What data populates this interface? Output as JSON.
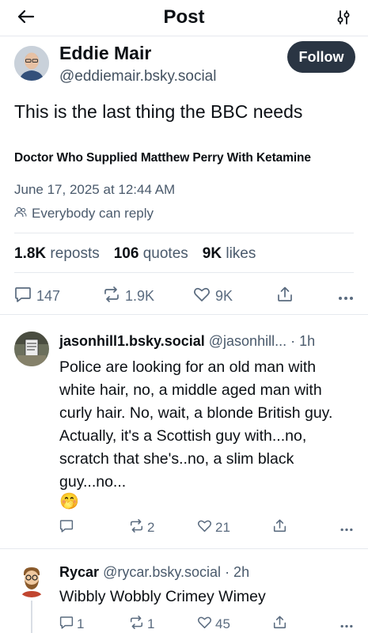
{
  "header": {
    "title": "Post",
    "back_icon": "arrow-left-icon",
    "settings_icon": "sliders-icon"
  },
  "post": {
    "author_name": "Eddie Mair",
    "author_handle": "@eddiemair.bsky.social",
    "follow_label": "Follow",
    "text": "This is the last thing the BBC needs",
    "headline": "Doctor Who Supplied Matthew Perry With Ketamine",
    "date": "June 17, 2025 at 12:44 AM",
    "reply_setting": "Everybody can reply",
    "stats": {
      "reposts_count": "1.8K",
      "reposts_label": "reposts",
      "quotes_count": "106",
      "quotes_label": "quotes",
      "likes_count": "9K",
      "likes_label": "likes"
    },
    "actions": {
      "replies": "147",
      "reposts": "1.9K",
      "likes": "9K"
    }
  },
  "replies": [
    {
      "name": "jasonhill1.bsky.social",
      "handle": "@jasonhill...",
      "time": "· 1h",
      "text": "Police are looking for an old man with white hair, no, a middle aged man with curly hair. No, wait, a blonde British guy. Actually, it's a Scottish guy with...no, scratch that she's..no, a slim black guy...no...",
      "emoji": "🤭",
      "actions": {
        "replies": "",
        "reposts": "2",
        "likes": "21"
      }
    },
    {
      "name": "Rycar",
      "handle": "@rycar.bsky.social",
      "time": "· 2h",
      "text": "Wibbly Wobbly Crimey Wimey",
      "actions": {
        "replies": "1",
        "reposts": "1",
        "likes": "45"
      }
    }
  ],
  "colors": {
    "follow_bg": "#2a3543",
    "muted": "#5a6b7f",
    "divider": "#e6e9ee"
  }
}
